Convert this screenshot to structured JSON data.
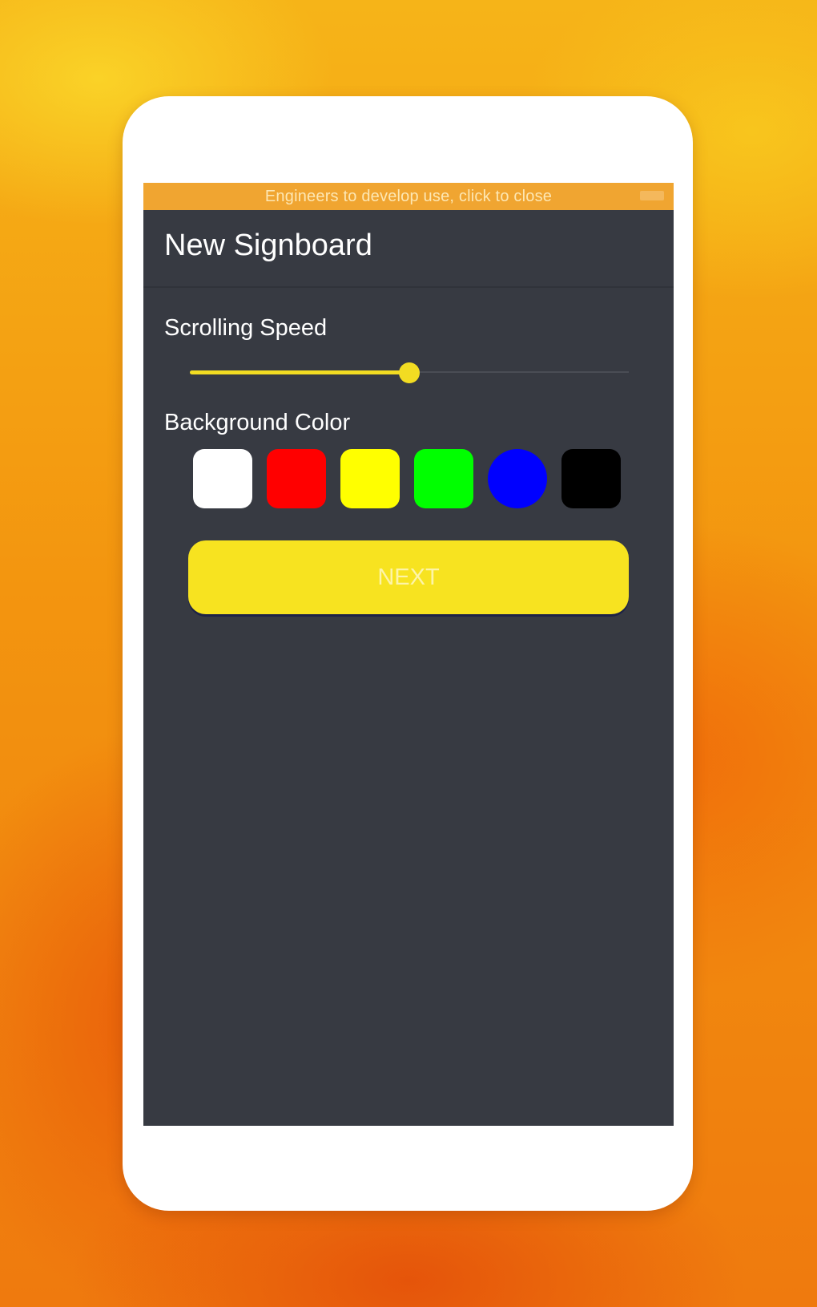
{
  "notice_bar": {
    "text": "Engineers to develop use, click to close"
  },
  "app_bar": {
    "title": "New Signboard"
  },
  "scrolling_speed": {
    "label": "Scrolling Speed",
    "value_fraction": 0.5,
    "accent_color": "#f2dc22"
  },
  "background_color": {
    "label": "Background Color",
    "options": [
      {
        "name": "white",
        "color": "#ffffff",
        "shape": "rounded-square"
      },
      {
        "name": "red",
        "color": "#ff0000",
        "shape": "rounded-square"
      },
      {
        "name": "yellow",
        "color": "#ffff00",
        "shape": "rounded-square"
      },
      {
        "name": "green",
        "color": "#00ff00",
        "shape": "rounded-square"
      },
      {
        "name": "blue",
        "color": "#0000ff",
        "shape": "circle"
      },
      {
        "name": "black",
        "color": "#000000",
        "shape": "rounded-square"
      }
    ],
    "selected": "blue"
  },
  "next_button": {
    "label": "NEXT",
    "color": "#f7e320"
  }
}
